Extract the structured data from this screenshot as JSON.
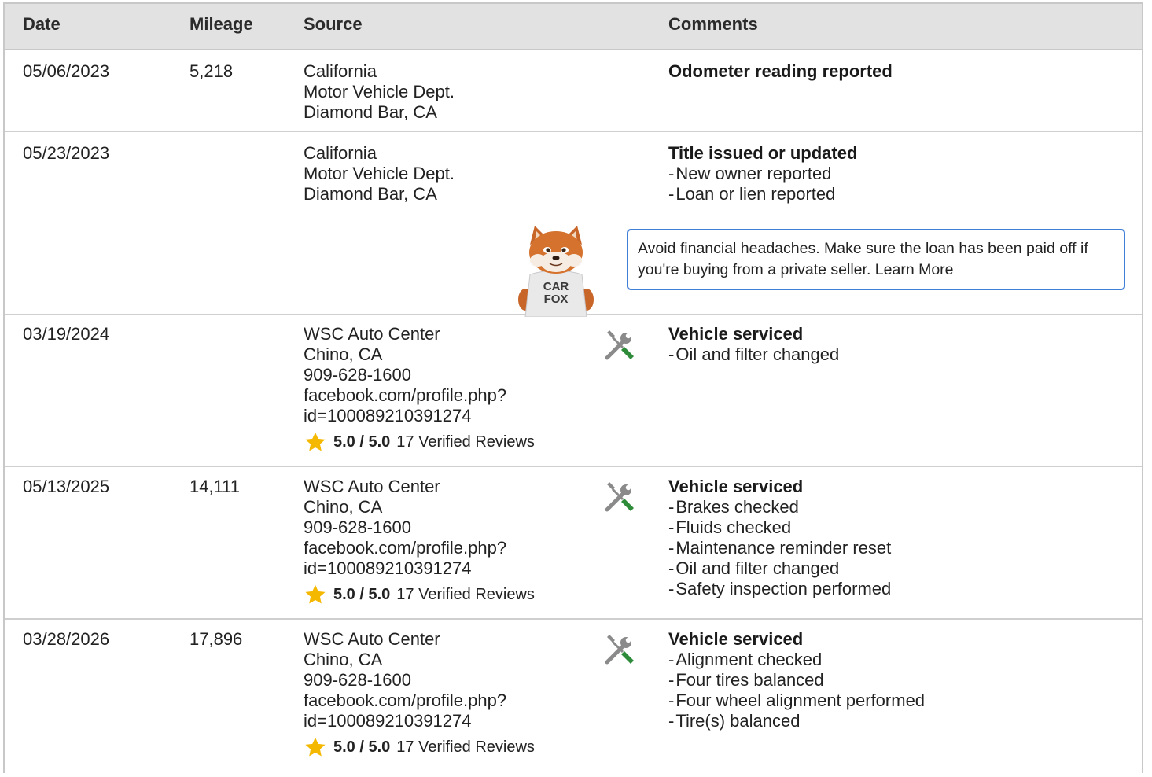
{
  "header": {
    "date": "Date",
    "mileage": "Mileage",
    "source": "Source",
    "comments": "Comments"
  },
  "rows": [
    {
      "date": "05/06/2023",
      "mileage": "5,218",
      "source": [
        "California",
        "Motor Vehicle Dept.",
        "Diamond Bar, CA"
      ],
      "comment_title": "Odometer reading reported",
      "comment_items": []
    },
    {
      "date": "05/23/2023",
      "mileage": "",
      "source": [
        "California",
        "Motor Vehicle Dept.",
        "Diamond Bar, CA"
      ],
      "comment_title": "Title issued or updated",
      "comment_items": [
        "New owner reported",
        "Loan or lien reported"
      ],
      "tip_text": "Avoid financial headaches. Make sure the loan has been paid off if you're buying from a private seller.",
      "tip_link": "Learn More",
      "mascot_text": [
        "CAR",
        "FOX"
      ]
    },
    {
      "date": "03/19/2024",
      "mileage": "",
      "source": [
        "WSC Auto Center",
        "Chino, CA",
        "909-628-1600",
        "facebook.com/profile.php?",
        "id=100089210391274"
      ],
      "rating_score": "5.0 / 5.0",
      "rating_reviews": "17 Verified Reviews",
      "comment_title": "Vehicle serviced",
      "comment_items": [
        "Oil and filter changed"
      ]
    },
    {
      "date": "05/13/2025",
      "mileage": "14,111",
      "source": [
        "WSC Auto Center",
        "Chino, CA",
        "909-628-1600",
        "facebook.com/profile.php?",
        "id=100089210391274"
      ],
      "rating_score": "5.0 / 5.0",
      "rating_reviews": "17 Verified Reviews",
      "comment_title": "Vehicle serviced",
      "comment_items": [
        "Brakes checked",
        "Fluids checked",
        "Maintenance reminder reset",
        "Oil and filter changed",
        "Safety inspection performed"
      ]
    },
    {
      "date": "03/28/2026",
      "mileage": "17,896",
      "source": [
        "WSC Auto Center",
        "Chino, CA",
        "909-628-1600",
        "facebook.com/profile.php?",
        "id=100089210391274"
      ],
      "rating_score": "5.0 / 5.0",
      "rating_reviews": "17 Verified Reviews",
      "comment_title": "Vehicle serviced",
      "comment_items": [
        "Alignment checked",
        "Four tires balanced",
        "Four wheel alignment performed",
        "Tire(s) balanced"
      ]
    }
  ],
  "icons": {
    "service": "wrench-screwdriver-icon",
    "rating": "star-icon",
    "mascot": "carfox-mascot"
  },
  "colors": {
    "header_bg": "#e2e2e2",
    "star": "#f5b800",
    "wrench": "#8a8a8a",
    "screwdriver": "#2e8b3a",
    "tip_border": "#3f7fd6"
  }
}
